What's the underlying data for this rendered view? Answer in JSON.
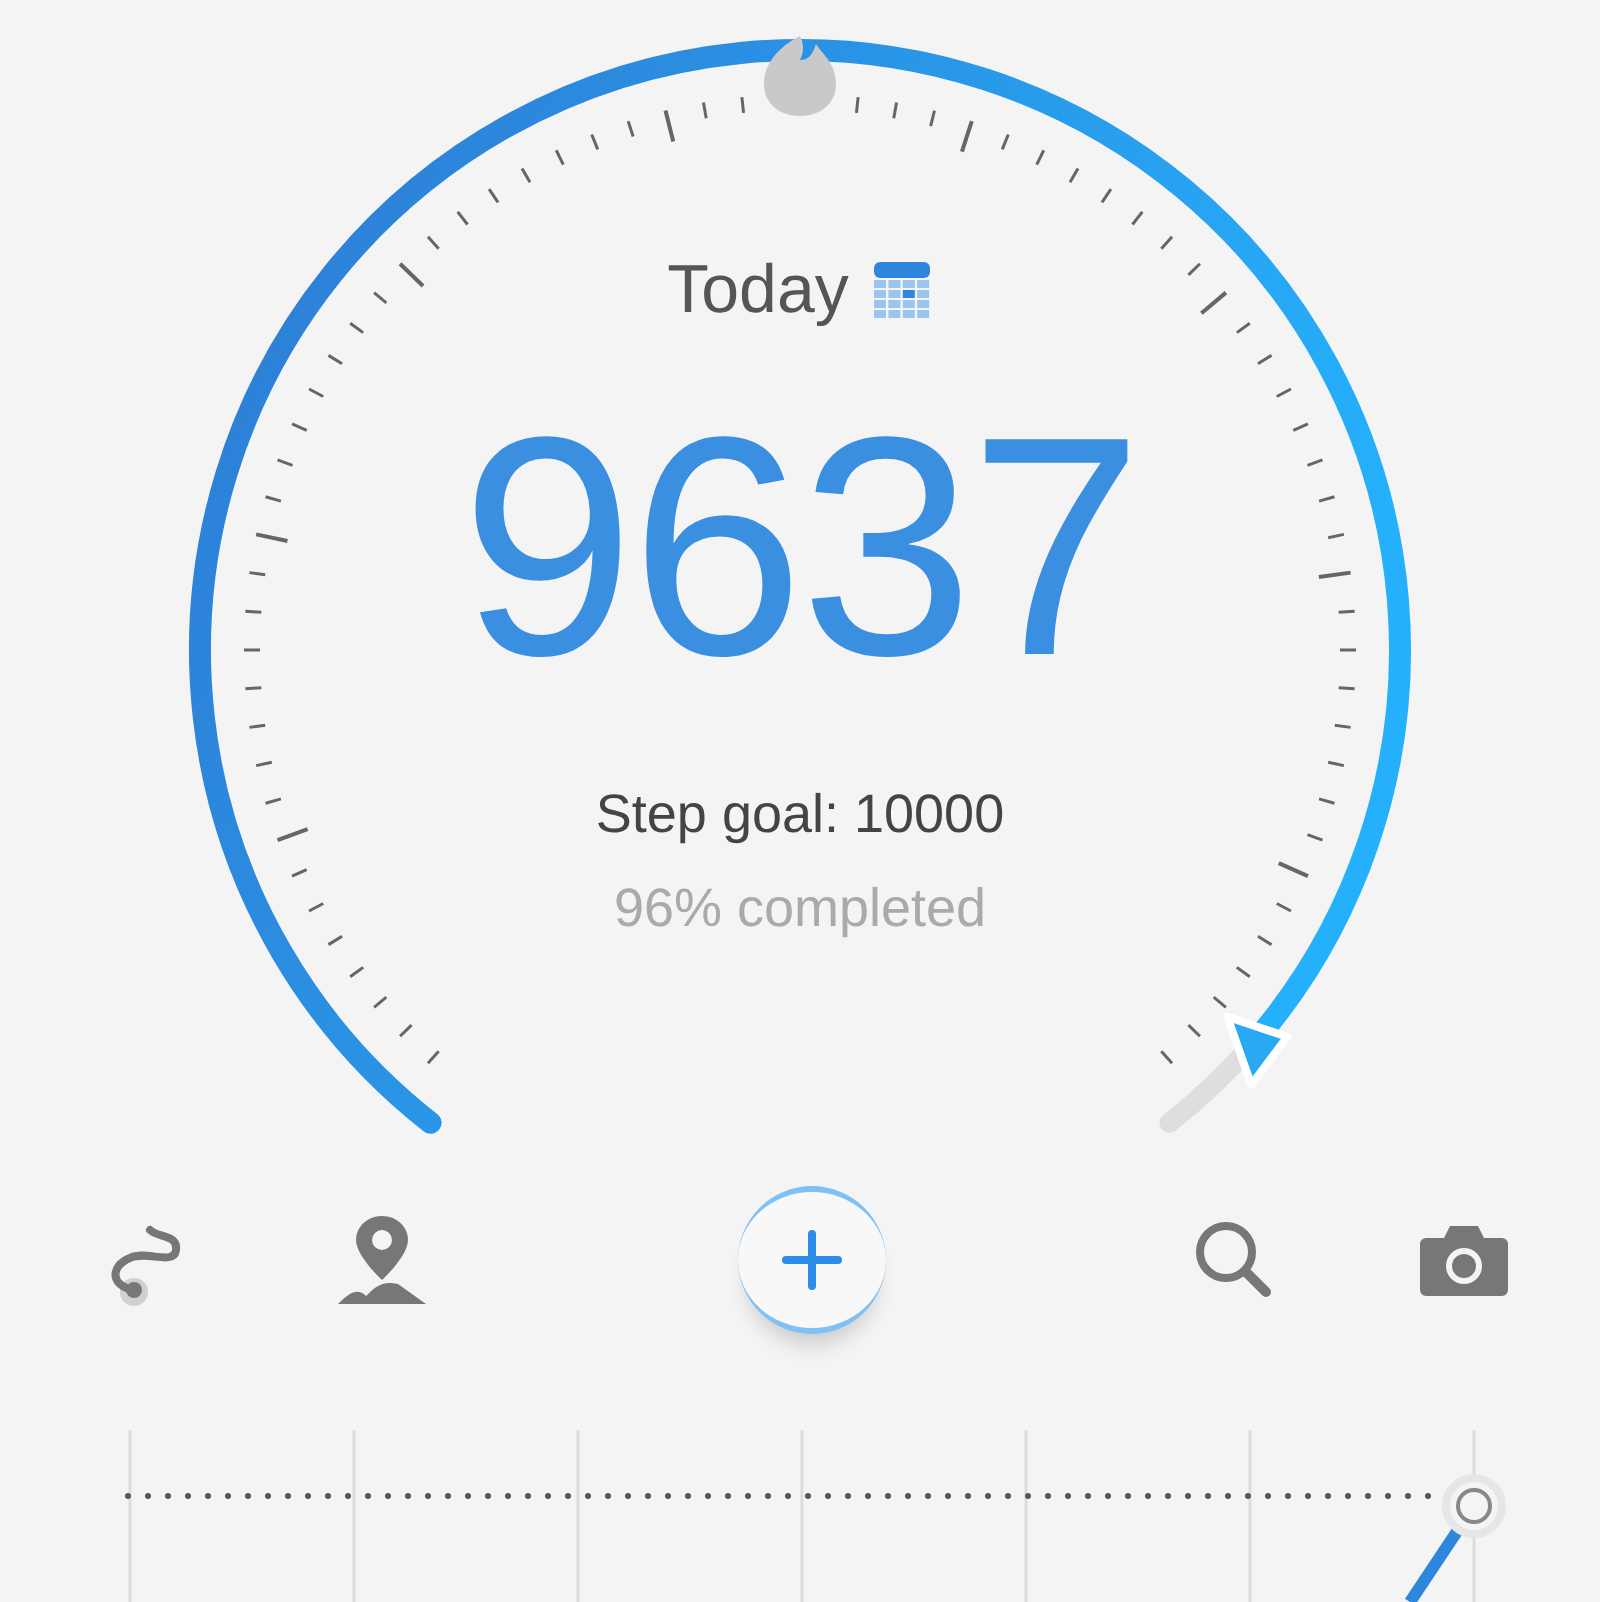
{
  "gauge": {
    "title": "Today",
    "steps": "9637",
    "goal": "Step goal: 10000",
    "completed": "96% completed"
  }
}
